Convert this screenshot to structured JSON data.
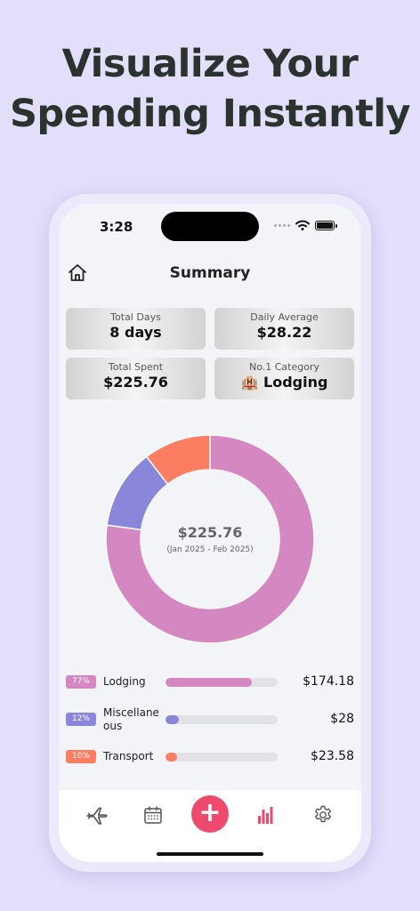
{
  "headline": {
    "line1": "Visualize Your",
    "line2": "Spending Instantly"
  },
  "status_bar": {
    "time": "3:28"
  },
  "header": {
    "title": "Summary"
  },
  "stats": [
    {
      "label": "Total Days",
      "value": "8 days"
    },
    {
      "label": "Daily Average",
      "value": "$28.22"
    },
    {
      "label": "Total Spent",
      "value": "$225.76"
    },
    {
      "label": "No.1 Category",
      "value": "🏨 Lodging"
    }
  ],
  "chart_data": {
    "type": "pie",
    "center_amount": "$225.76",
    "center_range": "(Jan 2025 - Feb 2025)",
    "slices": [
      {
        "name": "Lodging",
        "value": 174.18,
        "percent": 77,
        "color": "#d487c0"
      },
      {
        "name": "Miscellaneous",
        "value": 28,
        "percent": 12,
        "color": "#8a86d9"
      },
      {
        "name": "Transport",
        "value": 23.58,
        "percent": 10,
        "color": "#fb7e63"
      }
    ]
  },
  "breakdown": [
    {
      "percent_label": "77%",
      "name": "Lodging",
      "amount": "$174.18",
      "fill": 0.77,
      "color": "#d487c0"
    },
    {
      "percent_label": "12%",
      "name": "Miscellaneous",
      "amount": "$28",
      "fill": 0.12,
      "color": "#8a86d9"
    },
    {
      "percent_label": "10%",
      "name": "Transport",
      "amount": "$23.58",
      "fill": 0.1,
      "color": "#fb7e63"
    }
  ],
  "tabbar": {
    "items": [
      "airplane-icon",
      "calendar-icon",
      "add-button",
      "bar-chart-icon",
      "gear-icon"
    ],
    "add_label": "+",
    "active_color": "#ee4a6d"
  }
}
